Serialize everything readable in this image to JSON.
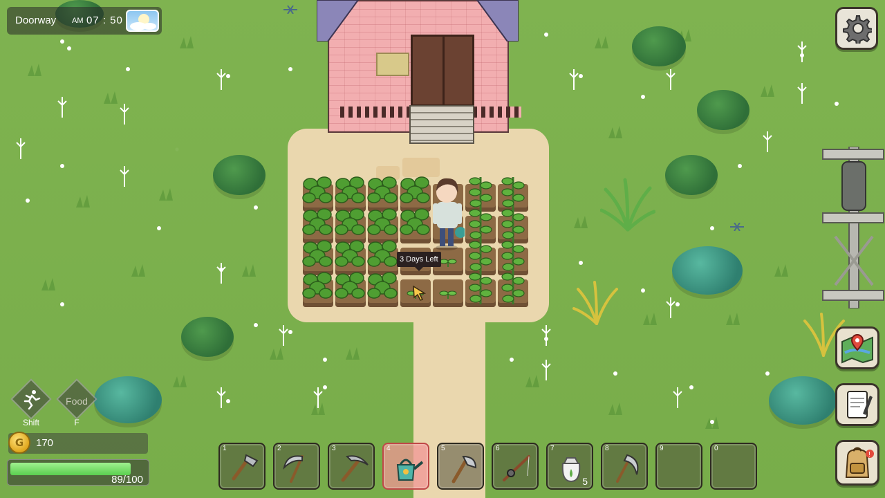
{
  "hud": {
    "location": "Doorway",
    "ampm": "AM",
    "time": "07 : 50",
    "weather_icon": "sunny-cloud-icon"
  },
  "crop_tooltip": "3 Days Left",
  "actions": {
    "run_label": "Shift",
    "food_label": "Food",
    "food_key": "F"
  },
  "money": {
    "amount": "170",
    "coin_symbol": "G"
  },
  "stamina": {
    "text": "89/100",
    "fraction": 0.89
  },
  "hotbar": [
    {
      "num": "1",
      "icon": "hoe-icon",
      "count": ""
    },
    {
      "num": "2",
      "icon": "scythe-icon",
      "count": ""
    },
    {
      "num": "3",
      "icon": "pickaxe-icon",
      "count": ""
    },
    {
      "num": "4",
      "icon": "watering-can-icon",
      "count": "",
      "active": true
    },
    {
      "num": "5",
      "icon": "axe-icon",
      "count": ""
    },
    {
      "num": "6",
      "icon": "fishing-rod-icon",
      "count": ""
    },
    {
      "num": "7",
      "icon": "seed-bag-icon",
      "count": "5"
    },
    {
      "num": "8",
      "icon": "sickle-icon",
      "count": ""
    },
    {
      "num": "9",
      "icon": "empty-slot",
      "count": ""
    },
    {
      "num": "0",
      "icon": "empty-slot",
      "count": ""
    }
  ],
  "menu_icons": [
    "settings-gear-icon",
    "map-icon",
    "journal-icon",
    "backpack-icon"
  ],
  "colors": {
    "grass": "#7fb350",
    "dirt_path": "#ead7ae",
    "stamina": "#5bcf4f",
    "active_slot": "#f09696"
  }
}
